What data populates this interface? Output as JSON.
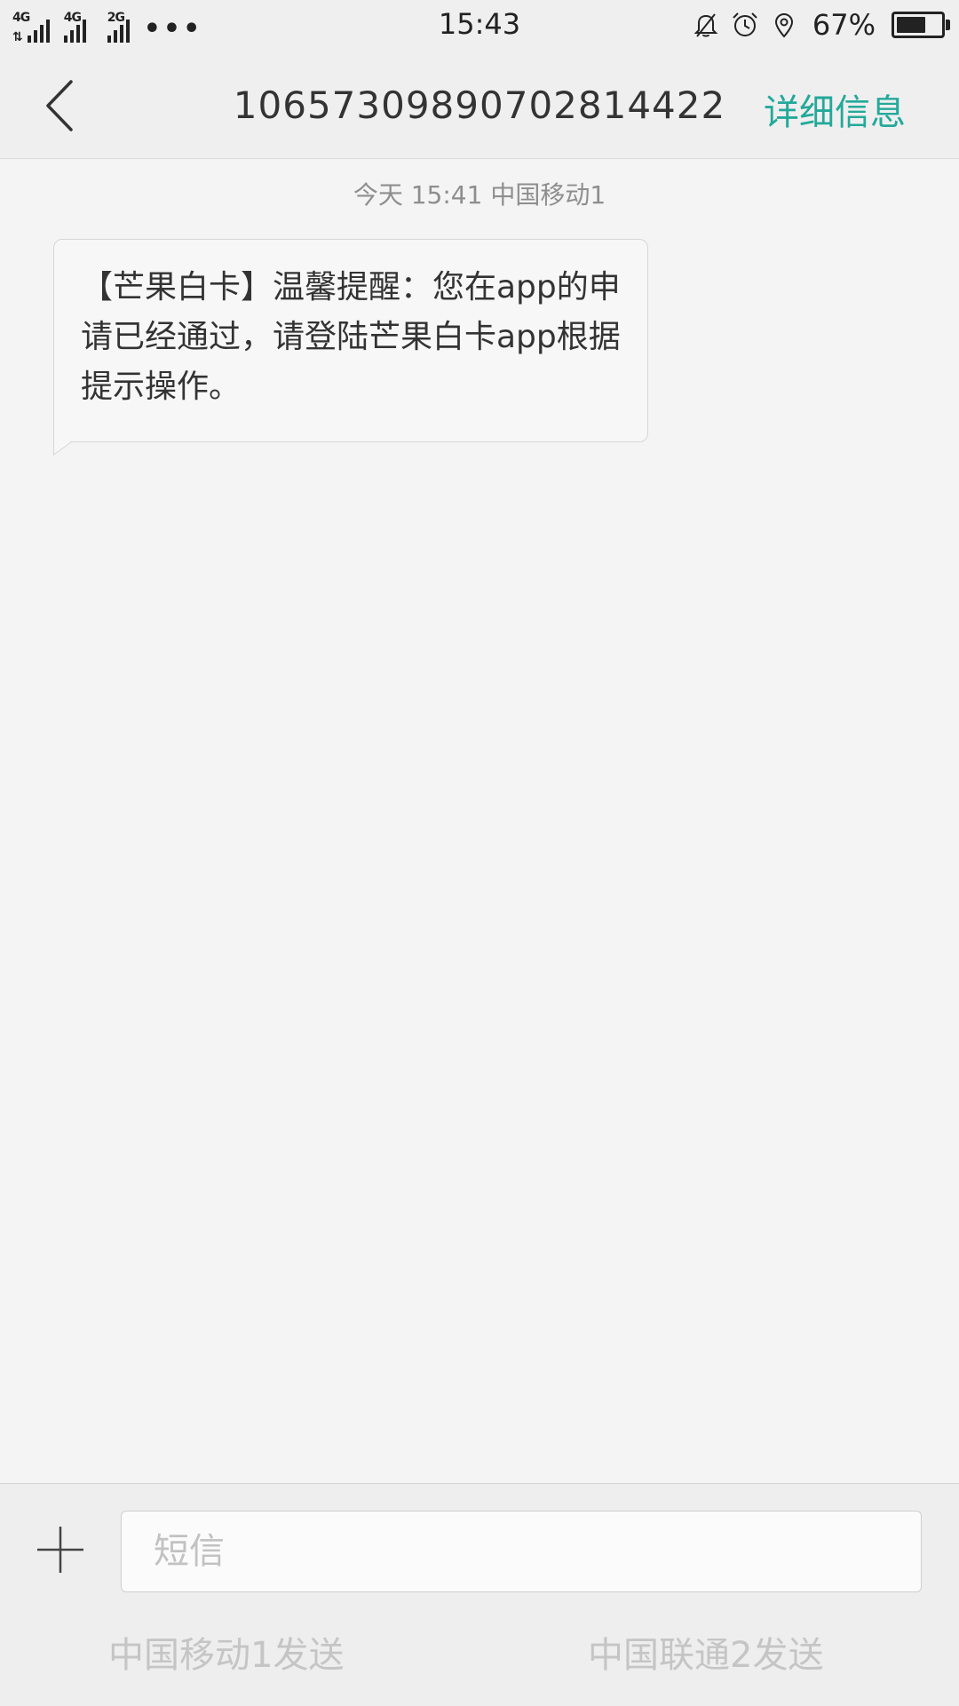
{
  "status_bar": {
    "network_1": "4G",
    "network_2": "4G",
    "network_3": "2G",
    "overflow": "•••",
    "time": "15:43",
    "battery_percent": "67%",
    "battery_level": 0.67,
    "icons": [
      "bell-off-icon",
      "alarm-clock-icon",
      "location-pin-icon",
      "battery-icon"
    ]
  },
  "header": {
    "back_icon": "chevron-left-icon",
    "title": "10657309890702814422",
    "details_label": "详细信息",
    "accent_color": "#23a99a"
  },
  "conversation": {
    "timestamp": "今天  15:41  中国移动1",
    "messages": [
      {
        "text": "【芒果白卡】温馨提醒：您在app的申请已经通过，请登陆芒果白卡app根据提示操作。"
      }
    ]
  },
  "compose": {
    "add_icon": "plus-icon",
    "placeholder": "短信",
    "value": "",
    "send_sim1_label": "中国移动1发送",
    "send_sim2_label": "中国联通2发送"
  }
}
